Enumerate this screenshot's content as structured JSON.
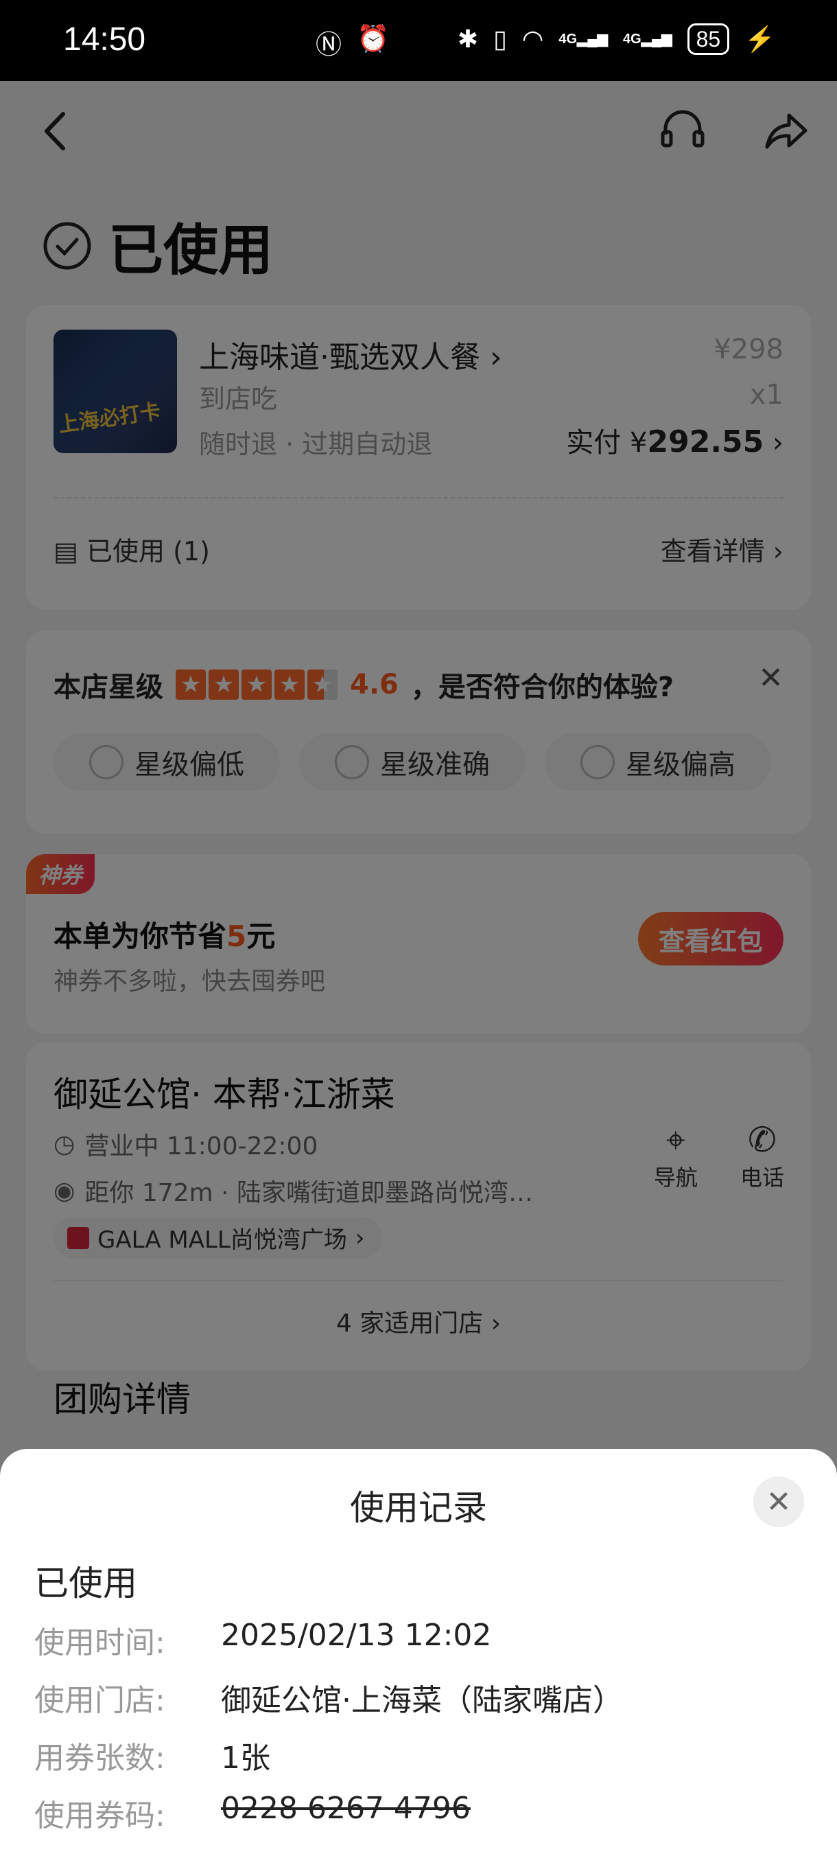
{
  "status_bar": {
    "time": "14:50",
    "battery": "85"
  },
  "page": {
    "title": "已使用"
  },
  "product": {
    "thumb_text": "上海必打卡",
    "name": "上海味道·甄选双人餐",
    "type": "到店吃",
    "refund_policy": "随时退 · 过期自动退",
    "original_price": "¥298",
    "quantity": "x1",
    "paid_label": "实付",
    "paid_currency": "¥",
    "paid_amount": "292.55",
    "used_count": "已使用 (1)",
    "view_details": "查看详情"
  },
  "rating": {
    "label": "本店星级",
    "score": "4.6",
    "question": "，是否符合你的体验?",
    "chips": [
      "星级偏低",
      "星级准确",
      "星级偏高"
    ]
  },
  "coupon": {
    "tag": "神券",
    "title_prefix": "本单为你节省",
    "amount": "5",
    "title_suffix": "元",
    "subtitle": "神券不多啦，快去囤券吧",
    "button": "查看红包"
  },
  "store": {
    "name": "御延公馆· 本帮·江浙菜",
    "hours": "营业中 11:00-22:00",
    "distance": "距你 172m · 陆家嘴街道即墨路尚悦湾…",
    "nav_label": "导航",
    "call_label": "电话",
    "mall": "GALA MALL尚悦湾广场",
    "applicable_stores": "4 家适用门店"
  },
  "section_peek": "团购详情",
  "usage_sheet": {
    "title": "使用记录",
    "status": "已使用",
    "rows": [
      {
        "label": "使用时间:",
        "value": "2025/02/13 12:02"
      },
      {
        "label": "使用门店:",
        "value": "御延公馆·上海菜（陆家嘴店）"
      },
      {
        "label": "用券张数:",
        "value": "1张"
      },
      {
        "label": "使用券码:",
        "value": "0228 6267 4796"
      }
    ]
  }
}
